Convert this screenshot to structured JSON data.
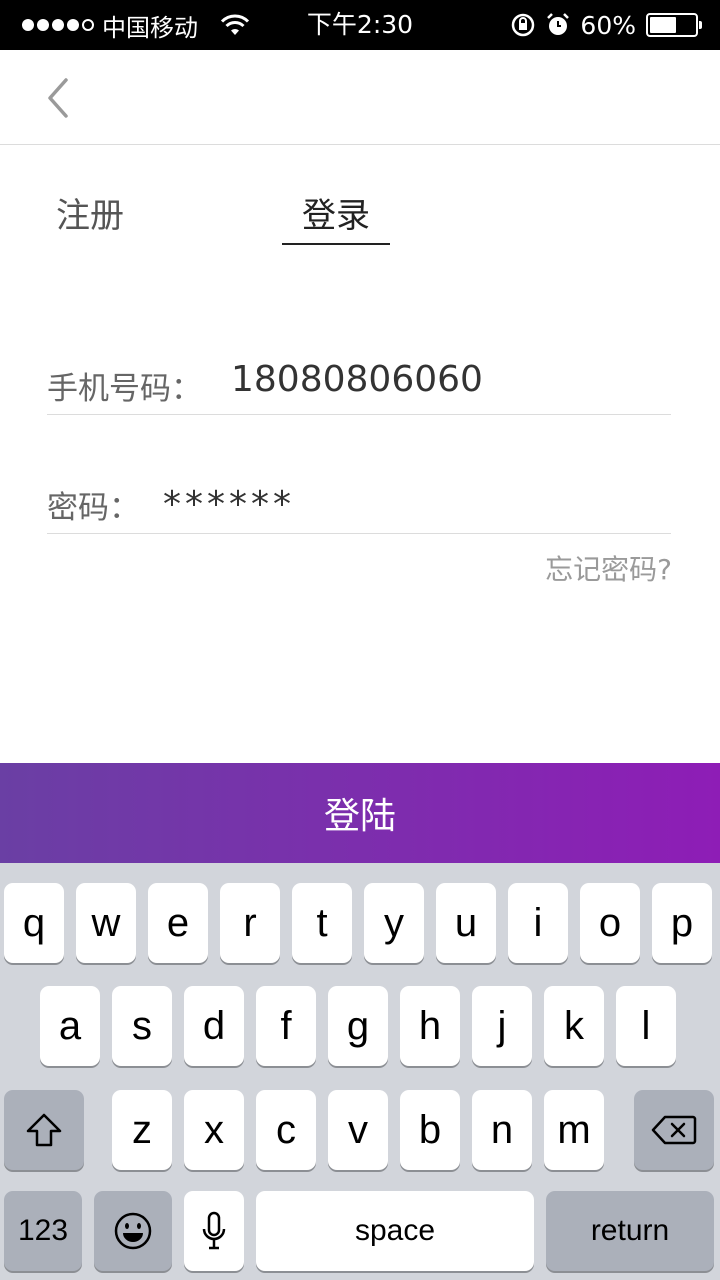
{
  "status_bar": {
    "carrier": "中国移动",
    "time": "下午2:30",
    "battery": "60%",
    "battery_level": 0.6,
    "icons": [
      "signal-dots-icon",
      "wifi-icon",
      "rotation-lock-icon",
      "alarm-icon",
      "battery-icon"
    ]
  },
  "nav": {
    "back_icon": "chevron-left-icon"
  },
  "tabs": {
    "register": "注册",
    "login": "登录",
    "active": "login"
  },
  "form": {
    "phone_label": "手机号码：",
    "phone_value": "18080806060",
    "password_label": "密码：",
    "password_value": "******",
    "forgot": "忘记密码?"
  },
  "login_button": {
    "label": "登陆",
    "gradient": [
      "#6a3fa4",
      "#8e1db6"
    ]
  },
  "keyboard": {
    "row1": [
      "q",
      "w",
      "e",
      "r",
      "t",
      "y",
      "u",
      "i",
      "o",
      "p"
    ],
    "row2": [
      "a",
      "s",
      "d",
      "f",
      "g",
      "h",
      "j",
      "k",
      "l"
    ],
    "row3": [
      "z",
      "x",
      "c",
      "v",
      "b",
      "n",
      "m"
    ],
    "numbers": "123",
    "space": "space",
    "return": "return",
    "icons": [
      "shift-icon",
      "backspace-icon",
      "emoji-icon",
      "microphone-icon"
    ]
  }
}
